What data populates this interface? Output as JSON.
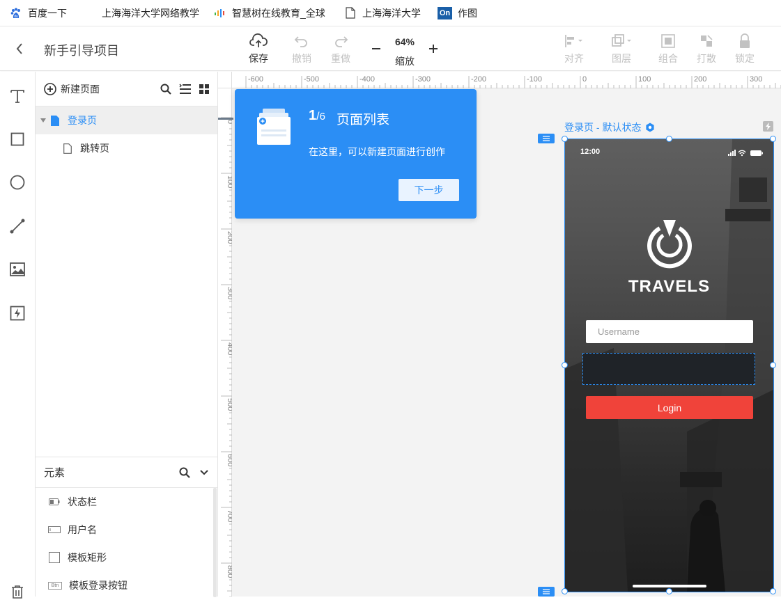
{
  "bookmarks": [
    {
      "label": "百度一下",
      "icon": "baidu-paw-icon"
    },
    {
      "label": "上海海洋大学网络教学",
      "icon": "blank-page-icon"
    },
    {
      "label": "智慧树在线教育_全球",
      "icon": "zhihuishu-icon"
    },
    {
      "label": "上海海洋大学",
      "icon": "document-icon"
    },
    {
      "label": "作图",
      "icon": "on-logo-icon",
      "icon_text": "On"
    }
  ],
  "toolbar": {
    "project_title": "新手引导项目",
    "save": "保存",
    "undo": "撤销",
    "redo": "重做",
    "zoom_value": "64%",
    "zoom_label": "缩放",
    "align": "对齐",
    "layer": "图层",
    "group": "组合",
    "ungroup": "打散",
    "lock": "锁定"
  },
  "pages_panel": {
    "new_page": "新建页面",
    "pages": [
      {
        "label": "登录页",
        "selected": true
      },
      {
        "label": "跳转页",
        "selected": false
      }
    ]
  },
  "elements_panel": {
    "title": "元素",
    "items": [
      {
        "label": "状态栏",
        "icon": "battery-icon"
      },
      {
        "label": "用户名",
        "icon": "input-field-icon"
      },
      {
        "label": "模板矩形",
        "icon": "square-icon"
      },
      {
        "label": "模板登录按钮",
        "icon": "btn-icon",
        "icon_text": "Btn"
      }
    ]
  },
  "ruler": {
    "h_labels": [
      "-600",
      "-500",
      "-400",
      "-300",
      "-200",
      "-100",
      "0",
      "100",
      "200",
      "300"
    ],
    "v_labels": [
      "0",
      "100",
      "200",
      "300",
      "400",
      "500",
      "600",
      "700",
      "800"
    ]
  },
  "guide": {
    "step_current": "1",
    "step_total": "6",
    "title": "页面列表",
    "description": "在这里，可以新建页面进行创作",
    "next_button": "下一步"
  },
  "artboard": {
    "label": "登录页 - 默认状态",
    "phone": {
      "time": "12:00",
      "brand": "TRAVELS",
      "username_placeholder": "Username",
      "login_button": "Login"
    }
  },
  "colors": {
    "accent": "#2b8ef5",
    "login_button": "#f0433a",
    "guide_bg": "#2b8ef5"
  }
}
